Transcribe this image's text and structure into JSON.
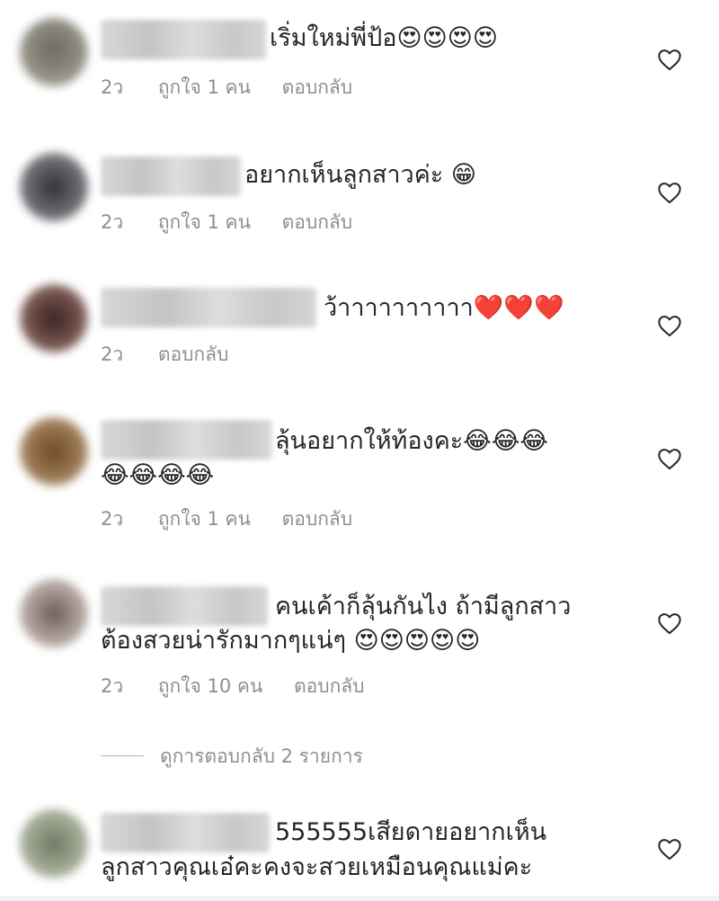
{
  "comments": [
    {
      "text_lines": [
        "เริ่มใหม่พี่ป้อ😍😍😍😍"
      ],
      "time": "2ว",
      "likes": "ถูกใจ 1 คน",
      "reply": "ตอบกลับ"
    },
    {
      "text_lines": [
        "อยากเห็นลูกสาวค่ะ 😁"
      ],
      "time": "2ว",
      "likes": "ถูกใจ 1 คน",
      "reply": "ตอบกลับ"
    },
    {
      "text_lines": [
        "ว้าาาาาาาาาา❤️❤️❤️"
      ],
      "time": "2ว",
      "reply": "ตอบกลับ"
    },
    {
      "text_lines": [
        "ลุ้นอยากให้ท้องคะ😂😂😂",
        "😂😂😂😂"
      ],
      "time": "2ว",
      "likes": "ถูกใจ 1 คน",
      "reply": "ตอบกลับ"
    },
    {
      "text_lines": [
        "คนเค้าก็ลุ้นกันไง ถ้ามีลูกสาว",
        "ต้องสวยน่ารักมากๆแน่ๆ 😍😍😍😍😍"
      ],
      "time": "2ว",
      "likes": "ถูกใจ 10 คน",
      "reply": "ตอบกลับ"
    },
    {
      "text_lines": [
        "555555เสียดายอยากเห็น",
        "ลูกสาวคุณเอ๋คะคงจะสวยเหมือนคุณแม่คะ"
      ]
    }
  ],
  "view_replies": "ดูการตอบกลับ 2 รายการ",
  "colors": {
    "text": "#262626",
    "secondary": "#8e8e8e",
    "heart_stroke": "#262626"
  },
  "icons": {
    "like": "heart-outline-icon"
  }
}
